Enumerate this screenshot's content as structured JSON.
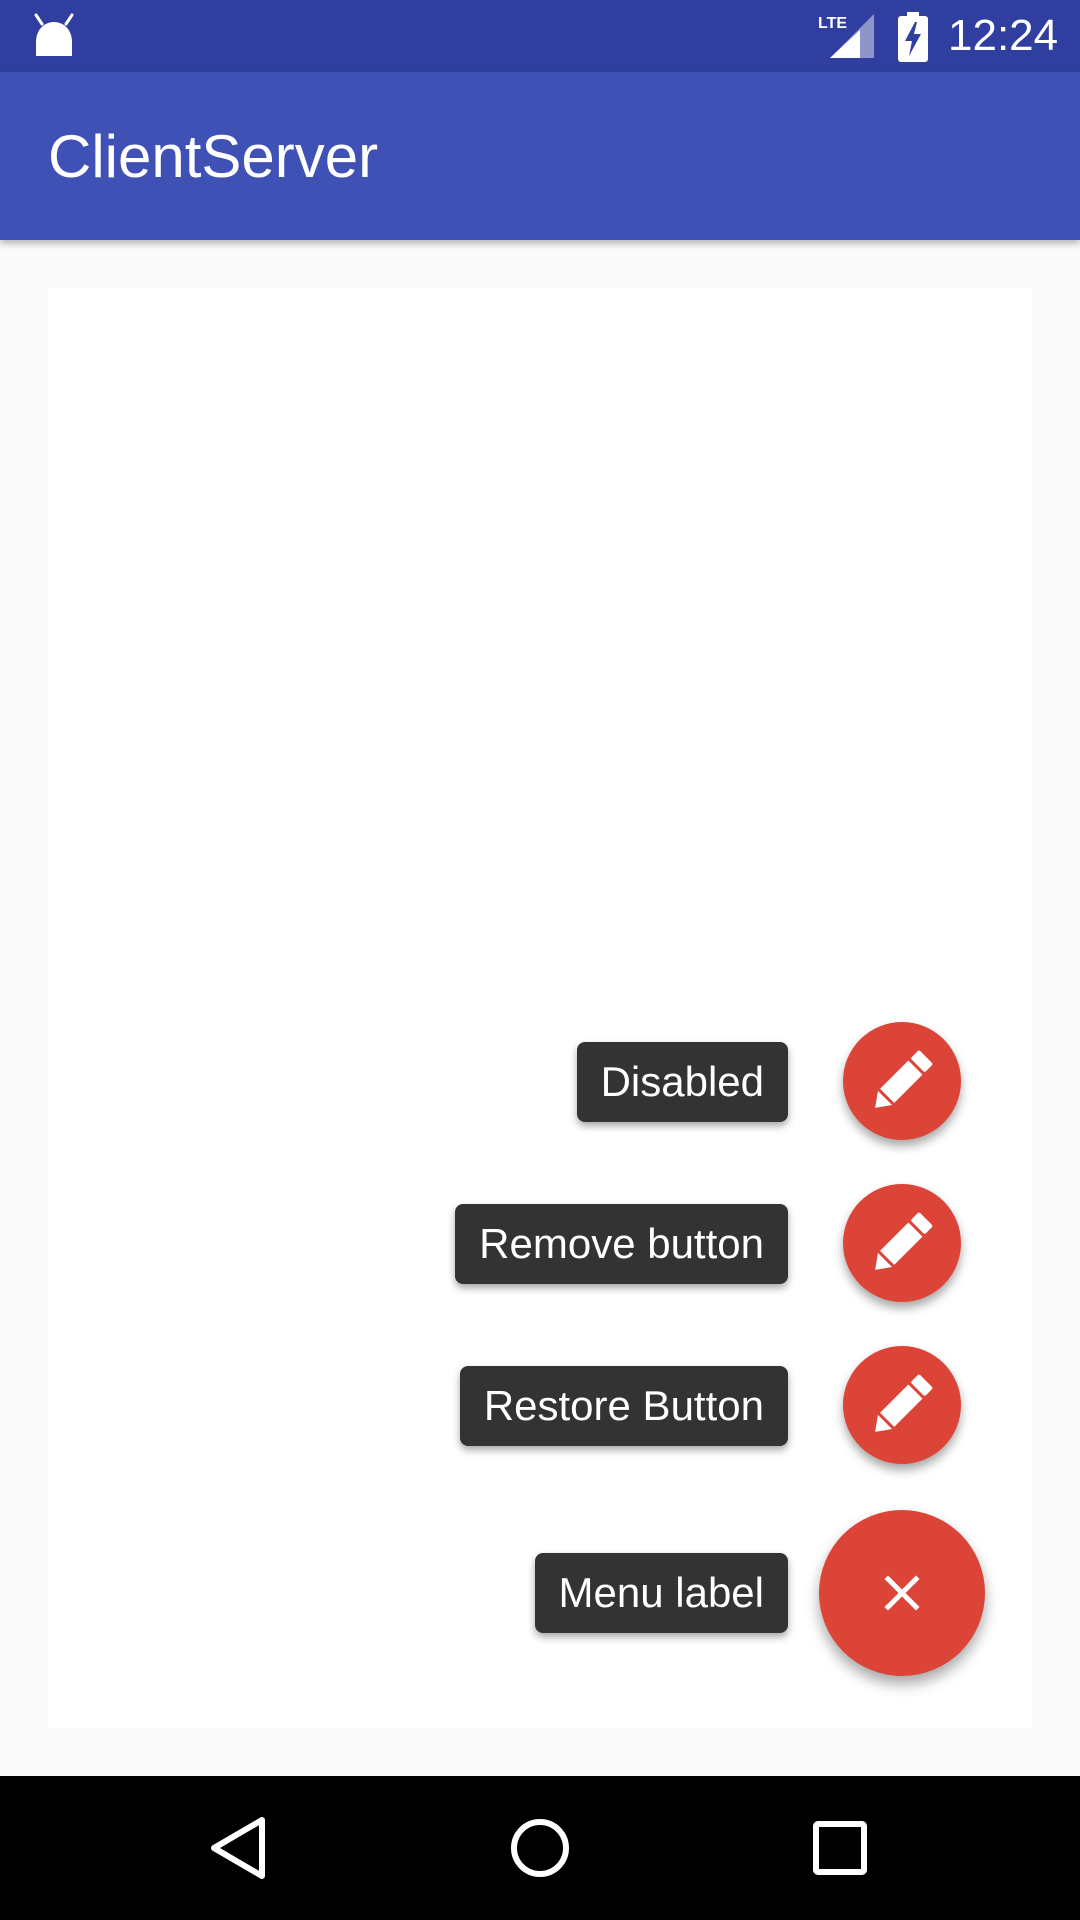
{
  "status_bar": {
    "time": "12:24",
    "network": "LTE",
    "icons": [
      "android-icon",
      "lte-signal-icon",
      "battery-charging-icon"
    ]
  },
  "app_bar": {
    "title": "ClientServer"
  },
  "fab_menu": {
    "items": [
      {
        "label": "Disabled",
        "icon": "pencil-icon"
      },
      {
        "label": "Remove button",
        "icon": "pencil-icon"
      },
      {
        "label": "Restore Button",
        "icon": "pencil-icon"
      }
    ],
    "menu_label": "Menu label",
    "main_icon": "close-icon",
    "accent_color": "#db4437"
  },
  "nav_bar": {
    "buttons": [
      "back-icon",
      "home-icon",
      "recents-icon"
    ]
  },
  "colors": {
    "status_bar": "#303f9f",
    "app_bar": "#3f51b5",
    "label_background": "#333333"
  }
}
